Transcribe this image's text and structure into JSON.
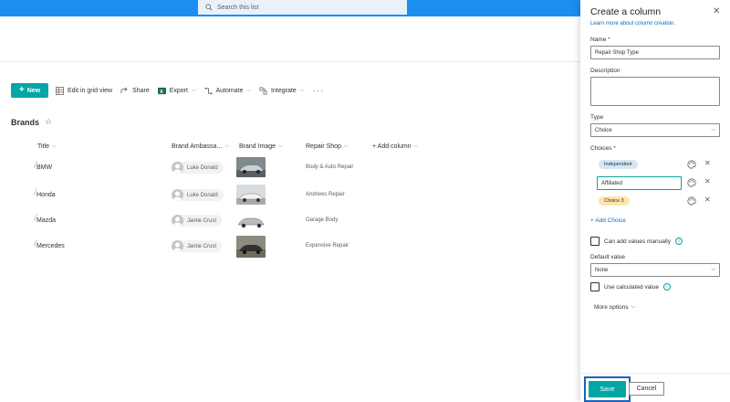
{
  "search": {
    "placeholder": "Search this list"
  },
  "commands": {
    "new": "New",
    "edit_grid": "Edit in grid view",
    "share": "Share",
    "export": "Export",
    "automate": "Automate",
    "integrate": "Integrate",
    "more": "···"
  },
  "list": {
    "title": "Brands",
    "columns": {
      "title": "Title",
      "brand_ambassador": "Brand Ambassa...",
      "brand_image": "Brand Image",
      "repair_shop": "Repair Shop",
      "add_column": "+ Add column"
    },
    "rows": [
      {
        "title": "BMW",
        "ambassador": "Luke Donald",
        "repair_shop": "Body & Auto Repair"
      },
      {
        "title": "Honda",
        "ambassador": "Luke Donald",
        "repair_shop": "Andrews Repair"
      },
      {
        "title": "Mazda",
        "ambassador": "Jamie Crust",
        "repair_shop": "Garage Body"
      },
      {
        "title": "Mercedes",
        "ambassador": "Jamie Crust",
        "repair_shop": "Expensive Repair"
      }
    ]
  },
  "panel": {
    "title": "Create a column",
    "learn_more": "Learn more about column creation.",
    "name_label": "Name",
    "name_value": "Repair Shop Type",
    "description_label": "Description",
    "type_label": "Type",
    "type_value": "Choice",
    "choices_label": "Choices",
    "choices": [
      {
        "label": "Independent",
        "color": "#d4e7f6"
      },
      {
        "label": "Affiliated",
        "color": "#ffffff"
      },
      {
        "label": "Choice 3",
        "color": "#fce6a8"
      }
    ],
    "add_choice": "+ Add Choice",
    "manual_values": "Can add values manually",
    "default_label": "Default value",
    "default_value": "None",
    "calculated": "Use calculated value",
    "more_options": "More options",
    "save": "Save",
    "cancel": "Cancel"
  },
  "colors": {
    "accent": "#03a6a6",
    "suitebar": "#1a8ff0",
    "link": "#0f6cbd"
  }
}
